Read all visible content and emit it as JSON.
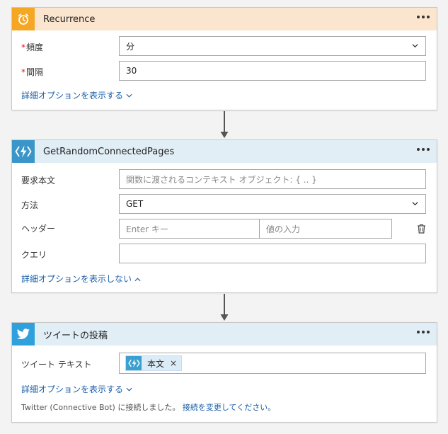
{
  "recurrence": {
    "title": "Recurrence",
    "header_color": "#fbe5ce",
    "icon_color": "#f5a623",
    "frequency_label": "頻度",
    "frequency_value": "分",
    "interval_label": "間隔",
    "interval_value": "30",
    "required_mark": "*",
    "advanced_link": "詳細オプションを表示する"
  },
  "function": {
    "title": "GetRandomConnectedPages",
    "header_color": "#e1eef6",
    "icon_color": "#3a96c9",
    "body_label": "要求本文",
    "body_placeholder": "関数に渡されるコンテキスト オブジェクト: { .. }",
    "method_label": "方法",
    "method_value": "GET",
    "headers_label": "ヘッダー",
    "header_key_placeholder": "Enter キー",
    "header_value_placeholder": "値の入力",
    "query_label": "クエリ",
    "query_value": "",
    "advanced_link": "詳細オプションを表示しない"
  },
  "tweet": {
    "title": "ツイートの投稿",
    "header_color": "#e1eef6",
    "icon_color": "#2fa0dc",
    "text_label": "ツイート テキスト",
    "token_label": "本文",
    "token_remove": "×",
    "advanced_link": "詳細オプションを表示する",
    "connection_text": "Twitter (Connective Bot) に接続しました。",
    "connection_link": "接続を変更してください。"
  },
  "icons": {
    "recurrence": "alarm-clock-icon",
    "function": "azure-function-icon",
    "twitter": "twitter-bird-icon",
    "more": "ellipsis-icon",
    "dropdown": "chevron-down-icon",
    "delete": "trash-icon",
    "arrow": "down-arrow-icon"
  }
}
